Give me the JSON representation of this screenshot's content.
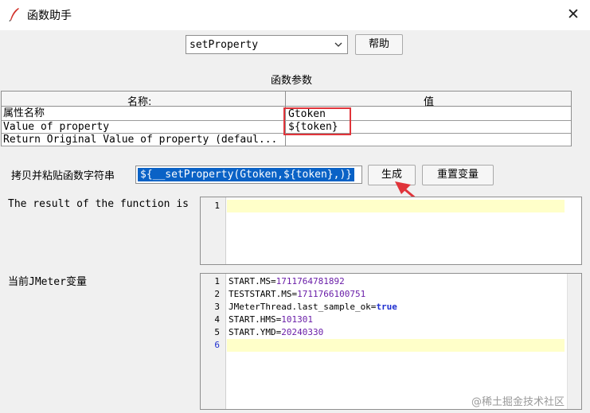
{
  "window": {
    "title": "函数助手",
    "close_glyph": "✕"
  },
  "function_selector": {
    "selected": "setProperty"
  },
  "buttons": {
    "help": "帮助",
    "generate": "生成",
    "reset": "重置变量"
  },
  "params": {
    "section_title": "函数参数",
    "headers": [
      "名称:",
      "值"
    ],
    "rows": [
      {
        "name": "属性名称",
        "value": "Gtoken"
      },
      {
        "name": "Value of property",
        "value": "${token}"
      },
      {
        "name": "Return Original Value of property (defaul...",
        "value": ""
      }
    ]
  },
  "copy": {
    "label": "拷贝并粘贴函数字符串",
    "value": "${__setProperty(Gtoken,${token},)}"
  },
  "result": {
    "label": "The result of the function is",
    "line_numbers": [
      "1"
    ]
  },
  "vars": {
    "label": "当前JMeter变量",
    "lines": [
      {
        "ln": "1",
        "key": "START.MS=",
        "val": "1711764781892"
      },
      {
        "ln": "2",
        "key": "TESTSTART.MS=",
        "val": "1711766100751"
      },
      {
        "ln": "3",
        "key": "JMeterThread.last_sample_ok=",
        "val": "true"
      },
      {
        "ln": "4",
        "key": "START.HMS=",
        "val": "101301"
      },
      {
        "ln": "5",
        "key": "START.YMD=",
        "val": "20240330"
      },
      {
        "ln": "6",
        "key": "",
        "val": ""
      }
    ]
  },
  "watermark": "@稀土掘金技术社区",
  "colors": {
    "highlight_box": "#e0343a",
    "arrow": "#e0343a",
    "selection": "#0a62c6",
    "current_line": "#ffffc9"
  }
}
